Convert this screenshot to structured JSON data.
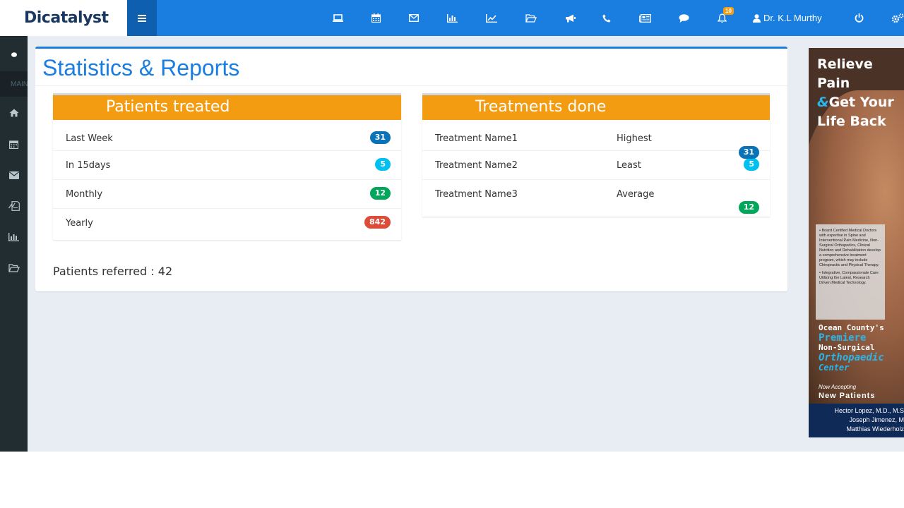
{
  "brand": {
    "logo": "Dicatalyst"
  },
  "topbar": {
    "icons": [
      "laptop-icon",
      "calendar-icon",
      "envelope-icon",
      "bar-chart-icon",
      "line-chart-icon",
      "folder-open-icon",
      "bullhorn-icon",
      "phone-icon",
      "newspaper-icon",
      "comment-icon",
      "bell-icon"
    ],
    "notification_count": "10",
    "user_name": "Dr. K.L Murthy"
  },
  "sidebar": {
    "section_label": "MAIN",
    "icons": [
      "circle-icon",
      "home-icon",
      "calendar-icon",
      "envelope-icon",
      "pdf-file-icon",
      "bar-chart-icon",
      "folder-open-icon"
    ]
  },
  "page": {
    "title": "Statistics & Reports",
    "patients_panel": {
      "title": "Patients treated",
      "rows": [
        {
          "label": "Last Week",
          "count": "31"
        },
        {
          "label": "In 15days",
          "count": "5"
        },
        {
          "label": "Monthly",
          "count": "12"
        },
        {
          "label": "Yearly",
          "count": "842"
        }
      ]
    },
    "treatments_panel": {
      "title": "Treatments done",
      "rows": [
        {
          "name": "Treatment Name1",
          "level": "Highest",
          "count": "31"
        },
        {
          "name": "Treatment Name2",
          "level": "Least",
          "count": "5"
        },
        {
          "name": "Treatment Name3",
          "level": "Average",
          "count": "12"
        }
      ]
    },
    "referred_label": "Patients referred : 42"
  },
  "ad": {
    "headline1": "Relieve Pain",
    "amp": "&",
    "headline2": "Get Your",
    "headline3": "Life Back",
    "bullet1": "• Board Certified Medical Doctors with expertise in Spine and Interventional Pain Medicine, Non-Surgical Orthopedics, Clinical Nutrition and Rehabilitation develop a comprehensive treatment program, which may include Chiropractic and Physical Therapy.",
    "bullet2": "• Integrative, Compassionate Care Utilizing the Latest, Research Driven Medical Technology.",
    "line1": "Ocean County's",
    "line2": "Premiere",
    "line3": "Non-Surgical",
    "line4": "Orthopaedic",
    "line5": "Center",
    "accepting": "Now Accepting",
    "new_patients": "New Patients",
    "doctor1": "Hector Lopez, M.D., M.S",
    "doctor2": "Joseph Jimenez, M",
    "doctor3": "Matthias Wiederholz"
  },
  "colors": {
    "primary": "#1a7de0",
    "orange": "#f39c12",
    "sidebar": "#222d32"
  }
}
